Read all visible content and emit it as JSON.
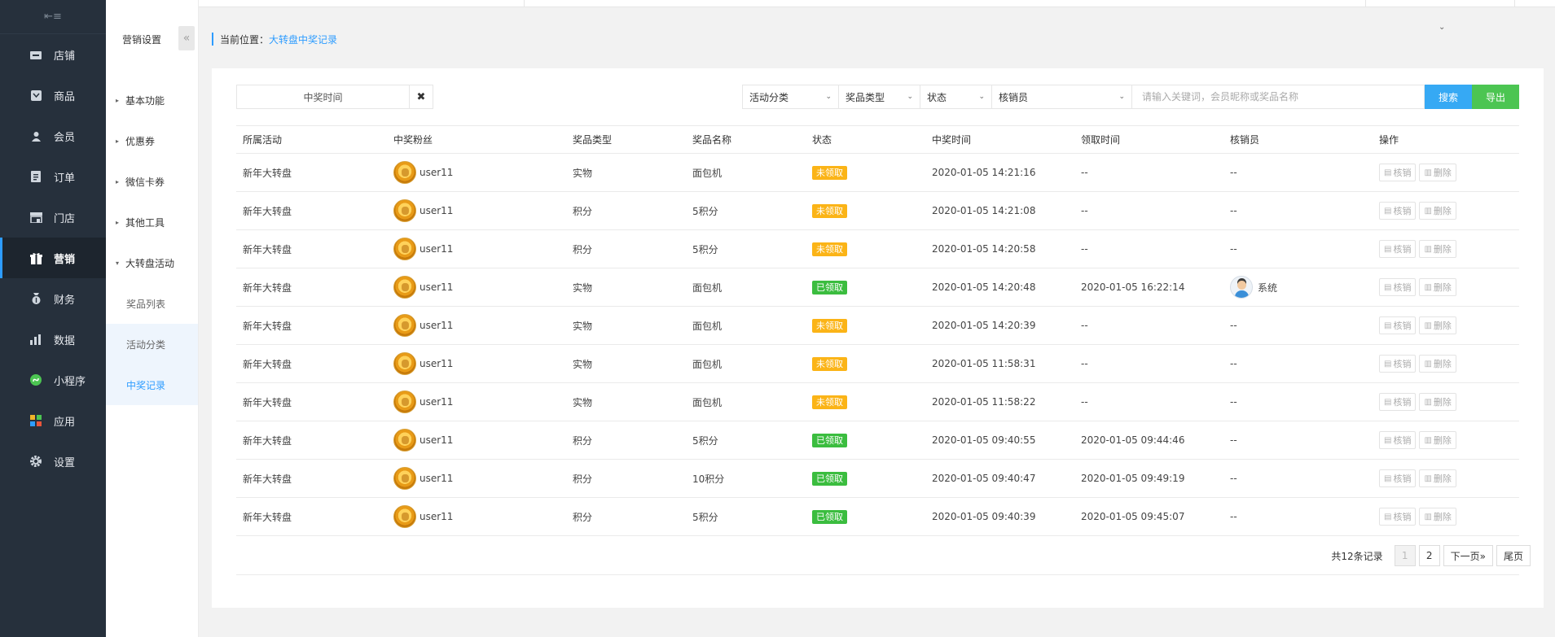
{
  "nav": {
    "items": [
      {
        "label": "店铺",
        "icon": "store-icon"
      },
      {
        "label": "商品",
        "icon": "goods-icon"
      },
      {
        "label": "会员",
        "icon": "member-icon"
      },
      {
        "label": "订单",
        "icon": "order-icon"
      },
      {
        "label": "门店",
        "icon": "shop-icon"
      },
      {
        "label": "营销",
        "icon": "gift-icon"
      },
      {
        "label": "财务",
        "icon": "finance-icon"
      },
      {
        "label": "数据",
        "icon": "chart-icon"
      },
      {
        "label": "小程序",
        "icon": "miniprogram-icon"
      },
      {
        "label": "应用",
        "icon": "apps-icon"
      },
      {
        "label": "设置",
        "icon": "gear-icon"
      }
    ],
    "active_index": 5
  },
  "submenu": {
    "title": "营销设置",
    "groups": [
      {
        "label": "基本功能"
      },
      {
        "label": "优惠券"
      },
      {
        "label": "微信卡券"
      },
      {
        "label": "其他工具"
      },
      {
        "label": "大转盘活动"
      }
    ],
    "children": [
      {
        "label": "奖品列表"
      },
      {
        "label": "活动分类"
      },
      {
        "label": "中奖记录"
      }
    ]
  },
  "breadcrumb": {
    "prefix": "当前位置：",
    "current": "大转盘中奖记录"
  },
  "filters": {
    "date_label": "中奖时间",
    "activity_category": "活动分类",
    "prize_type": "奖品类型",
    "status": "状态",
    "verifier": "核销员",
    "search_placeholder": "请输入关键词，会员昵称或奖品名称",
    "search_label": "搜索",
    "export_label": "导出"
  },
  "table": {
    "headers": [
      "所属活动",
      "中奖粉丝",
      "奖品类型",
      "奖品名称",
      "状态",
      "中奖时间",
      "领取时间",
      "核销员",
      "操作"
    ],
    "op_verify": "核销",
    "op_delete": "删除",
    "rows": [
      {
        "activity": "新年大转盘",
        "fan": "user11",
        "type": "实物",
        "prize": "面包机",
        "status": "未领取",
        "status_kind": "pending",
        "win_time": "2020-01-05 14:21:16",
        "claim_time": "--",
        "verifier": "--"
      },
      {
        "activity": "新年大转盘",
        "fan": "user11",
        "type": "积分",
        "prize": "5积分",
        "status": "未领取",
        "status_kind": "pending",
        "win_time": "2020-01-05 14:21:08",
        "claim_time": "--",
        "verifier": "--"
      },
      {
        "activity": "新年大转盘",
        "fan": "user11",
        "type": "积分",
        "prize": "5积分",
        "status": "未领取",
        "status_kind": "pending",
        "win_time": "2020-01-05 14:20:58",
        "claim_time": "--",
        "verifier": "--"
      },
      {
        "activity": "新年大转盘",
        "fan": "user11",
        "type": "实物",
        "prize": "面包机",
        "status": "已领取",
        "status_kind": "done",
        "win_time": "2020-01-05 14:20:48",
        "claim_time": "2020-01-05 16:22:14",
        "verifier": "系统",
        "verifier_avatar": true
      },
      {
        "activity": "新年大转盘",
        "fan": "user11",
        "type": "实物",
        "prize": "面包机",
        "status": "未领取",
        "status_kind": "pending",
        "win_time": "2020-01-05 14:20:39",
        "claim_time": "--",
        "verifier": "--"
      },
      {
        "activity": "新年大转盘",
        "fan": "user11",
        "type": "实物",
        "prize": "面包机",
        "status": "未领取",
        "status_kind": "pending",
        "win_time": "2020-01-05 11:58:31",
        "claim_time": "--",
        "verifier": "--"
      },
      {
        "activity": "新年大转盘",
        "fan": "user11",
        "type": "实物",
        "prize": "面包机",
        "status": "未领取",
        "status_kind": "pending",
        "win_time": "2020-01-05 11:58:22",
        "claim_time": "--",
        "verifier": "--"
      },
      {
        "activity": "新年大转盘",
        "fan": "user11",
        "type": "积分",
        "prize": "5积分",
        "status": "已领取",
        "status_kind": "done",
        "win_time": "2020-01-05 09:40:55",
        "claim_time": "2020-01-05 09:44:46",
        "verifier": "--"
      },
      {
        "activity": "新年大转盘",
        "fan": "user11",
        "type": "积分",
        "prize": "10积分",
        "status": "已领取",
        "status_kind": "done",
        "win_time": "2020-01-05 09:40:47",
        "claim_time": "2020-01-05 09:49:19",
        "verifier": "--"
      },
      {
        "activity": "新年大转盘",
        "fan": "user11",
        "type": "积分",
        "prize": "5积分",
        "status": "已领取",
        "status_kind": "done",
        "win_time": "2020-01-05 09:40:39",
        "claim_time": "2020-01-05 09:45:07",
        "verifier": "--"
      }
    ]
  },
  "pagination": {
    "total_text": "共12条记录",
    "pages": [
      "1",
      "2"
    ],
    "current": "1",
    "next": "下一页»",
    "last": "尾页"
  },
  "colors": {
    "accent": "#2d9cff",
    "pending": "#fbb417",
    "done": "#3bbd3f",
    "sidebar": "#26303c",
    "search_button": "#36a9f4",
    "export_button": "#4cc552"
  }
}
